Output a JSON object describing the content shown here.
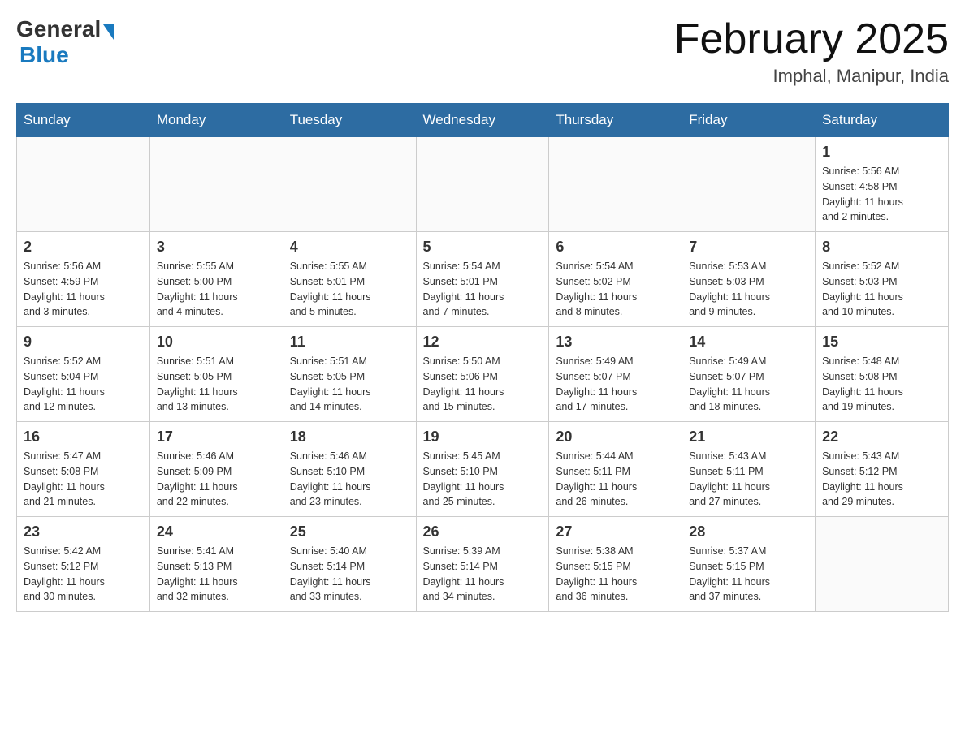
{
  "header": {
    "logo_general": "General",
    "logo_blue": "Blue",
    "title": "February 2025",
    "subtitle": "Imphal, Manipur, India"
  },
  "weekdays": [
    "Sunday",
    "Monday",
    "Tuesday",
    "Wednesday",
    "Thursday",
    "Friday",
    "Saturday"
  ],
  "weeks": [
    [
      {
        "day": "",
        "info": ""
      },
      {
        "day": "",
        "info": ""
      },
      {
        "day": "",
        "info": ""
      },
      {
        "day": "",
        "info": ""
      },
      {
        "day": "",
        "info": ""
      },
      {
        "day": "",
        "info": ""
      },
      {
        "day": "1",
        "info": "Sunrise: 5:56 AM\nSunset: 4:58 PM\nDaylight: 11 hours\nand 2 minutes."
      }
    ],
    [
      {
        "day": "2",
        "info": "Sunrise: 5:56 AM\nSunset: 4:59 PM\nDaylight: 11 hours\nand 3 minutes."
      },
      {
        "day": "3",
        "info": "Sunrise: 5:55 AM\nSunset: 5:00 PM\nDaylight: 11 hours\nand 4 minutes."
      },
      {
        "day": "4",
        "info": "Sunrise: 5:55 AM\nSunset: 5:01 PM\nDaylight: 11 hours\nand 5 minutes."
      },
      {
        "day": "5",
        "info": "Sunrise: 5:54 AM\nSunset: 5:01 PM\nDaylight: 11 hours\nand 7 minutes."
      },
      {
        "day": "6",
        "info": "Sunrise: 5:54 AM\nSunset: 5:02 PM\nDaylight: 11 hours\nand 8 minutes."
      },
      {
        "day": "7",
        "info": "Sunrise: 5:53 AM\nSunset: 5:03 PM\nDaylight: 11 hours\nand 9 minutes."
      },
      {
        "day": "8",
        "info": "Sunrise: 5:52 AM\nSunset: 5:03 PM\nDaylight: 11 hours\nand 10 minutes."
      }
    ],
    [
      {
        "day": "9",
        "info": "Sunrise: 5:52 AM\nSunset: 5:04 PM\nDaylight: 11 hours\nand 12 minutes."
      },
      {
        "day": "10",
        "info": "Sunrise: 5:51 AM\nSunset: 5:05 PM\nDaylight: 11 hours\nand 13 minutes."
      },
      {
        "day": "11",
        "info": "Sunrise: 5:51 AM\nSunset: 5:05 PM\nDaylight: 11 hours\nand 14 minutes."
      },
      {
        "day": "12",
        "info": "Sunrise: 5:50 AM\nSunset: 5:06 PM\nDaylight: 11 hours\nand 15 minutes."
      },
      {
        "day": "13",
        "info": "Sunrise: 5:49 AM\nSunset: 5:07 PM\nDaylight: 11 hours\nand 17 minutes."
      },
      {
        "day": "14",
        "info": "Sunrise: 5:49 AM\nSunset: 5:07 PM\nDaylight: 11 hours\nand 18 minutes."
      },
      {
        "day": "15",
        "info": "Sunrise: 5:48 AM\nSunset: 5:08 PM\nDaylight: 11 hours\nand 19 minutes."
      }
    ],
    [
      {
        "day": "16",
        "info": "Sunrise: 5:47 AM\nSunset: 5:08 PM\nDaylight: 11 hours\nand 21 minutes."
      },
      {
        "day": "17",
        "info": "Sunrise: 5:46 AM\nSunset: 5:09 PM\nDaylight: 11 hours\nand 22 minutes."
      },
      {
        "day": "18",
        "info": "Sunrise: 5:46 AM\nSunset: 5:10 PM\nDaylight: 11 hours\nand 23 minutes."
      },
      {
        "day": "19",
        "info": "Sunrise: 5:45 AM\nSunset: 5:10 PM\nDaylight: 11 hours\nand 25 minutes."
      },
      {
        "day": "20",
        "info": "Sunrise: 5:44 AM\nSunset: 5:11 PM\nDaylight: 11 hours\nand 26 minutes."
      },
      {
        "day": "21",
        "info": "Sunrise: 5:43 AM\nSunset: 5:11 PM\nDaylight: 11 hours\nand 27 minutes."
      },
      {
        "day": "22",
        "info": "Sunrise: 5:43 AM\nSunset: 5:12 PM\nDaylight: 11 hours\nand 29 minutes."
      }
    ],
    [
      {
        "day": "23",
        "info": "Sunrise: 5:42 AM\nSunset: 5:12 PM\nDaylight: 11 hours\nand 30 minutes."
      },
      {
        "day": "24",
        "info": "Sunrise: 5:41 AM\nSunset: 5:13 PM\nDaylight: 11 hours\nand 32 minutes."
      },
      {
        "day": "25",
        "info": "Sunrise: 5:40 AM\nSunset: 5:14 PM\nDaylight: 11 hours\nand 33 minutes."
      },
      {
        "day": "26",
        "info": "Sunrise: 5:39 AM\nSunset: 5:14 PM\nDaylight: 11 hours\nand 34 minutes."
      },
      {
        "day": "27",
        "info": "Sunrise: 5:38 AM\nSunset: 5:15 PM\nDaylight: 11 hours\nand 36 minutes."
      },
      {
        "day": "28",
        "info": "Sunrise: 5:37 AM\nSunset: 5:15 PM\nDaylight: 11 hours\nand 37 minutes."
      },
      {
        "day": "",
        "info": ""
      }
    ]
  ]
}
